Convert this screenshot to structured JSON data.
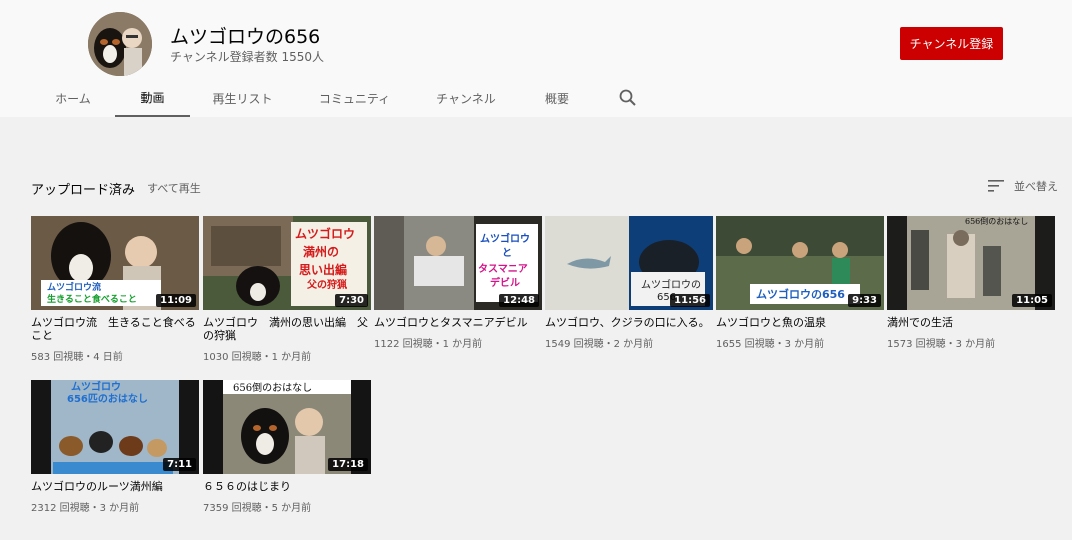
{
  "channel": {
    "name": "ムツゴロウの656",
    "subscribers": "チャンネル登録者数 1550人",
    "subscribe_label": "チャンネル登録"
  },
  "tabs": [
    {
      "label": "ホーム"
    },
    {
      "label": "動画",
      "active": true
    },
    {
      "label": "再生リスト"
    },
    {
      "label": "コミュニティ"
    },
    {
      "label": "チャンネル"
    },
    {
      "label": "概要"
    }
  ],
  "section": {
    "title": "アップロード済み",
    "play_all": "すべて再生",
    "sort_label": "並べ替え"
  },
  "videos": [
    {
      "title": "ムツゴロウ流　生きること食べること",
      "duration": "11:09",
      "meta": "583 回視聴・4 日前"
    },
    {
      "title": "ムツゴロウ　満州の思い出編　父の狩猟",
      "duration": "7:30",
      "meta": "1030 回視聴・1 か月前"
    },
    {
      "title": "ムツゴロウとタスマニアデビル",
      "duration": "12:48",
      "meta": "1122 回視聴・1 か月前"
    },
    {
      "title": "ムツゴロウ、クジラの口に入る。",
      "duration": "11:56",
      "meta": "1549 回視聴・2 か月前"
    },
    {
      "title": "ムツゴロウと魚の温泉",
      "duration": "9:33",
      "meta": "1655 回視聴・3 か月前"
    },
    {
      "title": "満州での生活",
      "duration": "11:05",
      "meta": "1573 回視聴・3 か月前"
    },
    {
      "title": "ムツゴロウのルーツ満州編",
      "duration": "7:11",
      "meta": "2312 回視聴・3 か月前"
    },
    {
      "title": "６５６のはじまり",
      "duration": "17:18",
      "meta": "7359 回視聴・5 か月前"
    }
  ],
  "icons": {
    "search": "search-icon",
    "sort": "sort-icon"
  },
  "colors": {
    "subscribe": "#cc0000",
    "header_bg": "#f9f9f9",
    "page_bg": "#f1f1f1"
  }
}
